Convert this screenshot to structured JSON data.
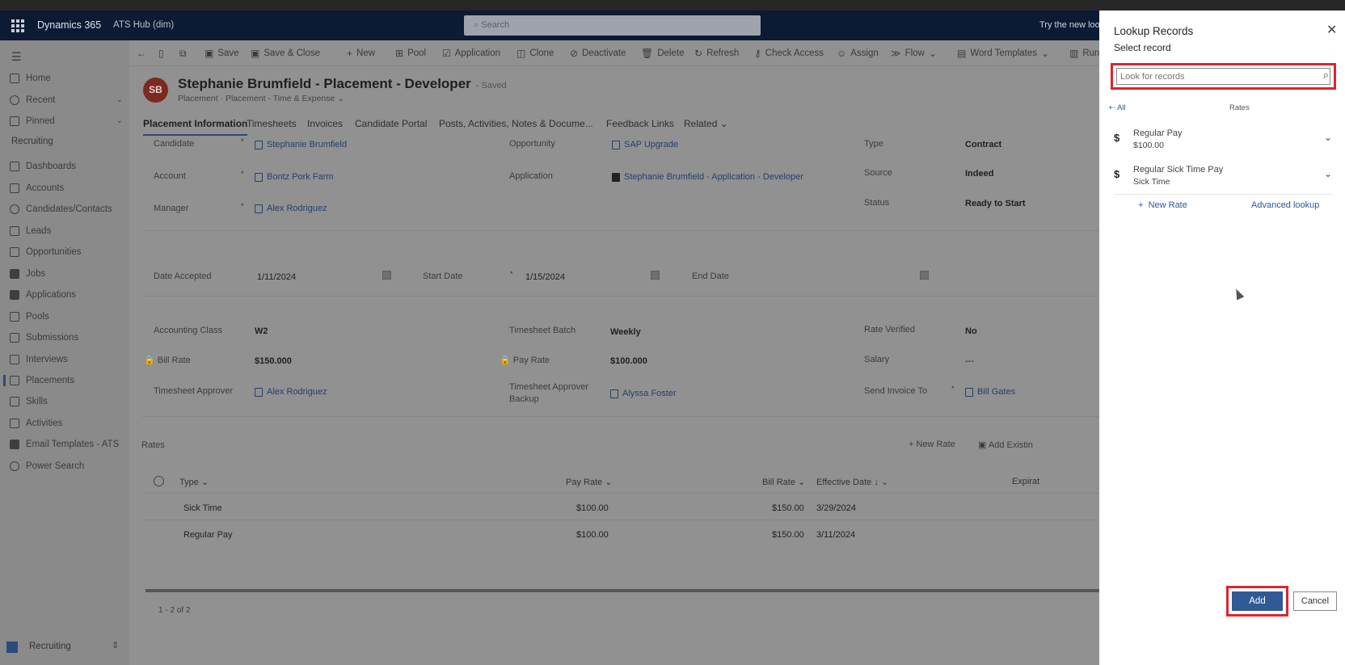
{
  "topbar": {
    "app_name": "Dynamics 365",
    "environment": "ATS Hub (dim)",
    "search_placeholder": "Search",
    "try_new": "Try the new loo"
  },
  "sidebar": {
    "items": [
      {
        "label": "Home"
      },
      {
        "label": "Recent"
      },
      {
        "label": "Pinned"
      }
    ],
    "section": "Recruiting",
    "nav": [
      {
        "label": "Dashboards"
      },
      {
        "label": "Accounts"
      },
      {
        "label": "Candidates/Contacts"
      },
      {
        "label": "Leads"
      },
      {
        "label": "Opportunities"
      },
      {
        "label": "Jobs"
      },
      {
        "label": "Applications"
      },
      {
        "label": "Pools"
      },
      {
        "label": "Submissions"
      },
      {
        "label": "Interviews"
      },
      {
        "label": "Placements"
      },
      {
        "label": "Skills"
      },
      {
        "label": "Activities"
      },
      {
        "label": "Email Templates - ATS"
      },
      {
        "label": "Power Search"
      }
    ],
    "area": "Recruiting"
  },
  "commandbar": {
    "items": [
      "Save",
      "Save & Close",
      "New",
      "Pool",
      "Application",
      "Clone",
      "Deactivate",
      "Delete",
      "Refresh",
      "Check Access",
      "Assign",
      "Flow",
      "Word Templates",
      "Run"
    ]
  },
  "record": {
    "initials": "SB",
    "title": "Stephanie Brumfield - Placement - Developer",
    "saved": "- Saved",
    "entity": "Placement",
    "form": "Placement - Time & Expense"
  },
  "tabs": [
    "Placement Information",
    "Timesheets",
    "Invoices",
    "Candidate Portal",
    "Posts, Activities, Notes & Docume...",
    "Feedback Links",
    "Related"
  ],
  "fields": {
    "candidate_label": "Candidate",
    "candidate": "Stephanie Brumfield",
    "account_label": "Account",
    "account": "Bontz Pork Farm",
    "manager_label": "Manager",
    "manager": "Alex Rodriguez",
    "opportunity_label": "Opportunity",
    "opportunity": "SAP Upgrade",
    "application_label": "Application",
    "application": "Stephanie Brumfield - Application - Developer",
    "type_label": "Type",
    "type": "Contract",
    "source_label": "Source",
    "source": "Indeed",
    "status_label": "Status",
    "status": "Ready to Start",
    "date_accepted_label": "Date Accepted",
    "date_accepted": "1/11/2024",
    "start_date_label": "Start Date",
    "start_date": "1/15/2024",
    "end_date_label": "End Date",
    "accounting_class_label": "Accounting Class",
    "accounting_class": "W2",
    "timesheet_batch_label": "Timesheet Batch",
    "timesheet_batch": "Weekly",
    "rate_verified_label": "Rate Verified",
    "rate_verified": "No",
    "bill_rate_label": "Bill Rate",
    "bill_rate": "$150.000",
    "pay_rate_label": "Pay Rate",
    "pay_rate": "$100.000",
    "salary_label": "Salary",
    "salary": "---",
    "approver_label": "Timesheet Approver",
    "approver": "Alex Rodriguez",
    "approver_backup_label": "Timesheet Approver Backup",
    "approver_backup": "Alyssa Foster",
    "send_invoice_label": "Send Invoice To",
    "send_invoice": "Bill Gates"
  },
  "rates_grid": {
    "title": "Rates",
    "new_rate": "New Rate",
    "add_existing": "Add Existin",
    "columns": [
      "Type",
      "Pay Rate",
      "Bill Rate",
      "Effective Date",
      "Expirat"
    ],
    "rows": [
      {
        "type": "Sick Time",
        "pay": "$100.00",
        "bill": "$150.00",
        "date": "3/29/2024"
      },
      {
        "type": "Regular Pay",
        "pay": "$100.00",
        "bill": "$150.00",
        "date": "3/11/2024"
      }
    ],
    "footer": "1 - 2 of 2"
  },
  "panel": {
    "title": "Lookup Records",
    "subtitle": "Select record",
    "search_placeholder": "Look for records",
    "all_link": "All",
    "entity": "Rates",
    "records": [
      {
        "name": "Regular Pay",
        "detail": "$100.00"
      },
      {
        "name": "Regular Sick Time Pay",
        "detail": "Sick Time"
      }
    ],
    "new_rate": "New Rate",
    "advanced": "Advanced lookup",
    "add": "Add",
    "cancel": "Cancel"
  }
}
